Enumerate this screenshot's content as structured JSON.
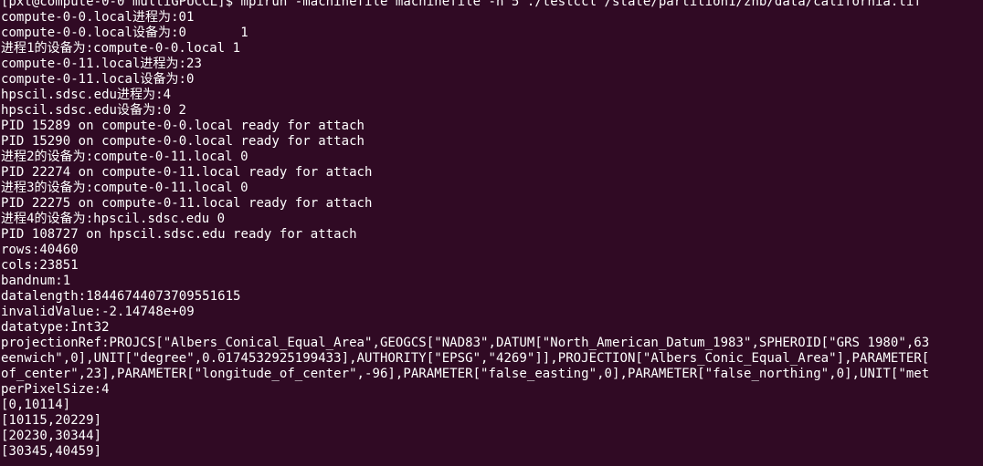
{
  "terminal": {
    "lines": [
      "[pxt@compute-0-0 multiGPUCCL]$ mpirun -machinefile machinefile -n 5 ./testccl /state/partition1/zhb/data/california.tif",
      "compute-0-0.local进程为:01",
      "compute-0-0.local设备为:0       1",
      "进程1的设备为:compute-0-0.local 1",
      "compute-0-11.local进程为:23",
      "compute-0-11.local设备为:0",
      "hpscil.sdsc.edu进程为:4",
      "hpscil.sdsc.edu设备为:0 2",
      "PID 15289 on compute-0-0.local ready for attach",
      "PID 15290 on compute-0-0.local ready for attach",
      "进程2的设备为:compute-0-11.local 0",
      "PID 22274 on compute-0-11.local ready for attach",
      "进程3的设备为:compute-0-11.local 0",
      "PID 22275 on compute-0-11.local ready for attach",
      "进程4的设备为:hpscil.sdsc.edu 0",
      "PID 108727 on hpscil.sdsc.edu ready for attach",
      "rows:40460",
      "cols:23851",
      "bandnum:1",
      "datalength:18446744073709551615",
      "invalidValue:-2.14748e+09",
      "datatype:Int32",
      "projectionRef:PROJCS[\"Albers_Conical_Equal_Area\",GEOGCS[\"NAD83\",DATUM[\"North_American_Datum_1983\",SPHEROID[\"GRS 1980\",63",
      "eenwich\",0],UNIT[\"degree\",0.0174532925199433],AUTHORITY[\"EPSG\",\"4269\"]],PROJECTION[\"Albers_Conic_Equal_Area\"],PARAMETER[",
      "of_center\",23],PARAMETER[\"longitude_of_center\",-96],PARAMETER[\"false_easting\",0],PARAMETER[\"false_northing\",0],UNIT[\"met",
      "perPixelSize:4",
      "[0,10114]",
      "[10115,20229]",
      "[20230,30344]",
      "[30345,40459]"
    ]
  }
}
